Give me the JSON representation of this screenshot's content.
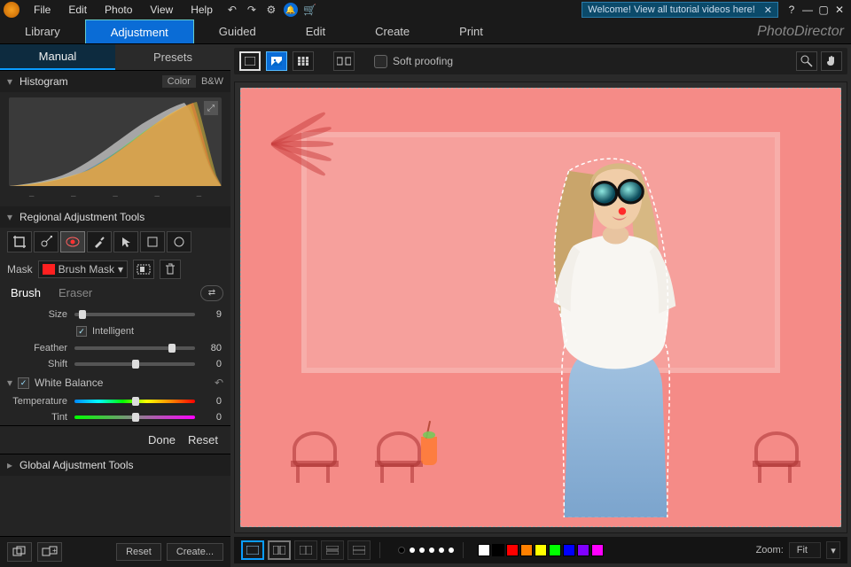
{
  "titlebar": {
    "menus": [
      "File",
      "Edit",
      "Photo",
      "View",
      "Help"
    ],
    "promo": "Welcome! View all tutorial videos here!"
  },
  "mainnav": {
    "items": [
      "Library",
      "Adjustment",
      "Guided",
      "Edit",
      "Create",
      "Print"
    ],
    "active": 1,
    "brand": "PhotoDirector"
  },
  "subtabs": {
    "manual": "Manual",
    "presets": "Presets"
  },
  "histogram": {
    "title": "Histogram",
    "mode_color": "Color",
    "mode_bw": "B&W"
  },
  "regional": {
    "title": "Regional Adjustment Tools",
    "mask_label": "Mask",
    "mask_name": "Brush Mask",
    "brush_tab": "Brush",
    "eraser_tab": "Eraser",
    "size_label": "Size",
    "size_value": "9",
    "intelligent_label": "Intelligent",
    "feather_label": "Feather",
    "feather_value": "80",
    "shift_label": "Shift",
    "shift_value": "0"
  },
  "whitebalance": {
    "title": "White Balance",
    "temp_label": "Temperature",
    "temp_value": "0",
    "tint_label": "Tint",
    "tint_value": "0"
  },
  "actions": {
    "done": "Done",
    "reset": "Reset"
  },
  "global": {
    "title": "Global Adjustment Tools"
  },
  "bottom": {
    "reset": "Reset",
    "create": "Create..."
  },
  "canvastoolbar": {
    "softproof": "Soft proofing"
  },
  "colors": [
    "#ffffff",
    "#000000",
    "#ff0000",
    "#ff8000",
    "#ffff00",
    "#00ff00",
    "#0000ff",
    "#8000ff",
    "#ff00ff"
  ],
  "zoom": {
    "label": "Zoom:",
    "value": "Fit"
  }
}
